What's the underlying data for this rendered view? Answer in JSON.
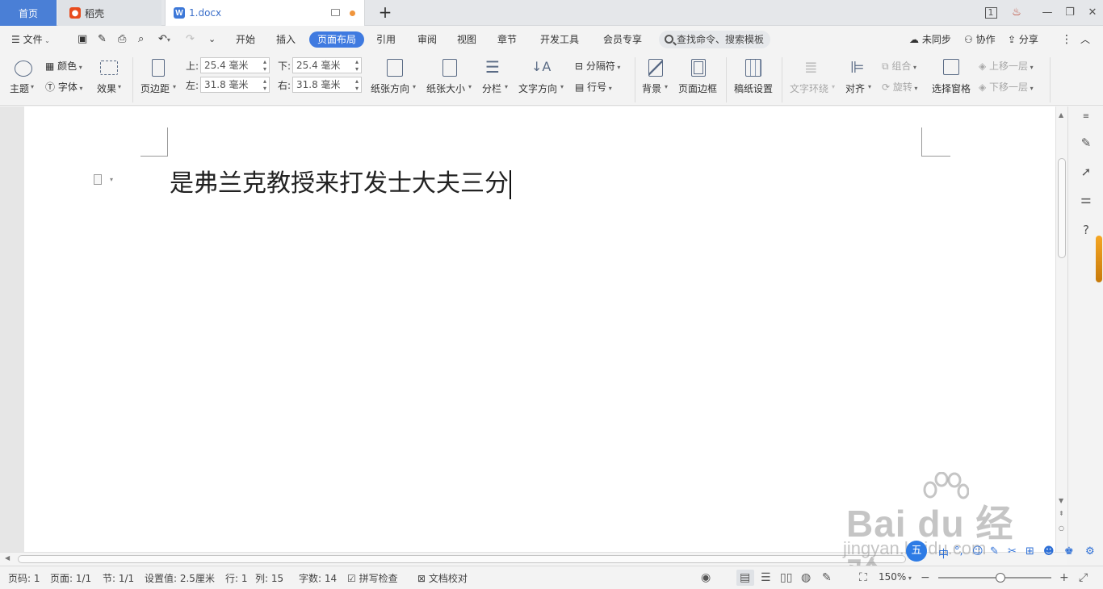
{
  "tabs": {
    "home": "首页",
    "daoke": "稻壳",
    "doc": "1.docx",
    "doc_icon": "W"
  },
  "menu": {
    "file": "文件",
    "items": [
      "开始",
      "插入",
      "页面布局",
      "引用",
      "审阅",
      "视图",
      "章节",
      "开发工具",
      "会员专享"
    ],
    "active_index": 2,
    "search_placeholder": "查找命令、搜索模板",
    "sync": "未同步",
    "collab": "协作",
    "share": "分享"
  },
  "ribbon": {
    "theme": "主题",
    "color": "颜色",
    "font": "字体",
    "effect": "效果",
    "margin": "页边距",
    "top_label": "上:",
    "top_value": "25.4 毫米",
    "bottom_label": "下:",
    "bottom_value": "25.4 毫米",
    "left_label": "左:",
    "left_value": "31.8 毫米",
    "right_label": "右:",
    "right_value": "31.8 毫米",
    "orientation": "纸张方向",
    "size": "纸张大小",
    "columns": "分栏",
    "text_direction": "文字方向",
    "separator": "分隔符",
    "line_number": "行号",
    "background": "背景",
    "page_border": "页面边框",
    "manuscript": "稿纸设置",
    "text_wrap": "文字环绕",
    "align": "对齐",
    "group": "组合",
    "rotate": "旋转",
    "selection_pane": "选择窗格",
    "bring_forward": "上移一层",
    "send_backward": "下移一层"
  },
  "document": {
    "text": "是弗兰克教授来打发士大夫三分"
  },
  "watermark": {
    "main": "Bai du 经验",
    "sub": "jingyan.baidu.com"
  },
  "status": {
    "page_num": "页码: 1",
    "pages": "页面: 1/1",
    "section": "节: 1/1",
    "setting": "设置值: 2.5厘米",
    "row": "行: 1",
    "col": "列: 15",
    "word_count": "字数: 14",
    "spell_check": "拼写检查",
    "doc_proof": "文档校对",
    "zoom": "150%",
    "zoom_fraction": 0.55
  },
  "colors": {
    "accent": "#3f7ae0",
    "home_tab": "#4a7fd6",
    "doc_tab_text": "#3b6fc9",
    "daoke_icon": "#e84c1e",
    "modified_dot": "#f0953c"
  }
}
